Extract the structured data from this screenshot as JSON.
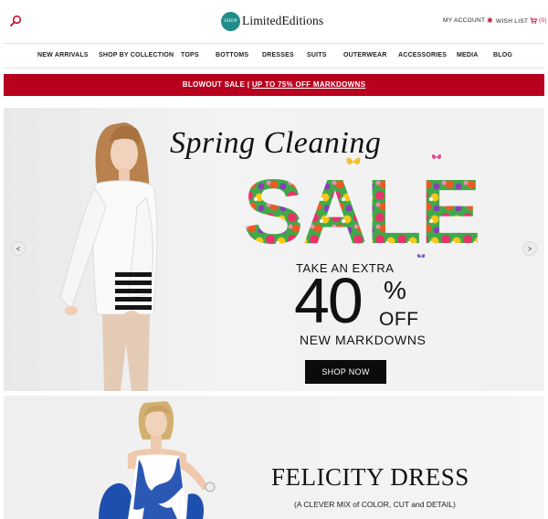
{
  "header": {
    "logo_badge": "SHOP",
    "logo_text": "LimitedEditions",
    "my_account": "MY ACCOUNT",
    "wish_list": "WISH LIST",
    "cart_count": "(0)"
  },
  "nav": {
    "items": [
      "NEW ARRIVALS",
      "SHOP BY COLLECTION",
      "TOPS",
      "BOTTOMS",
      "DRESSES",
      "SUITS",
      "OUTERWEAR",
      "ACCESSORIES",
      "MEDIA",
      "BLOG"
    ]
  },
  "promo": {
    "lead": "BLOWOUT SALE | ",
    "link": "UP TO 75% OFF MARKDOWNS"
  },
  "hero": {
    "prev": "<",
    "next": ">",
    "title": "Spring Cleaning",
    "sale_word": "SALE",
    "take_extra": "TAKE AN EXTRA",
    "amount": "40",
    "percent": "%",
    "off": "OFF",
    "subline": "NEW MARKDOWNS",
    "cta": "SHOP NOW"
  },
  "feature": {
    "title": "FELICITY DRESS",
    "subtitle": "(A CLEVER MIX of COLOR, CUT and DETAIL)"
  },
  "colors": {
    "brand_teal": "#1f8d89",
    "sale_red": "#b8001f",
    "accent_red": "#c4122f",
    "cta_black": "#0b0b0b"
  }
}
